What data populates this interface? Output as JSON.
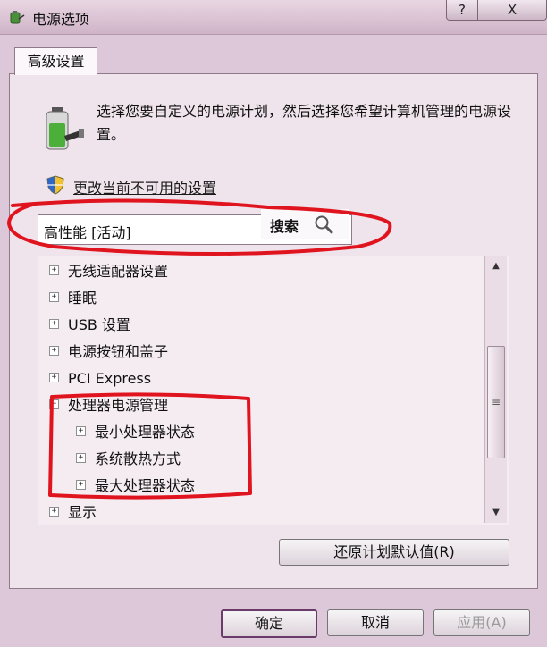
{
  "window": {
    "title": "电源选项",
    "help_button": "?",
    "close_button": "X"
  },
  "tab": {
    "label": "高级设置"
  },
  "description": "选择您要自定义的电源计划，然后选择您希望计算机管理的电源设置。",
  "link": "更改当前不可用的设置",
  "plan_select": {
    "value": "高性能 [活动]"
  },
  "search": {
    "label": "搜索"
  },
  "tree": {
    "items": [
      {
        "label": "无线适配器设置",
        "expander": "+"
      },
      {
        "label": "睡眠",
        "expander": "+"
      },
      {
        "label": "USB 设置",
        "expander": "+"
      },
      {
        "label": "电源按钮和盖子",
        "expander": "+"
      },
      {
        "label": "PCI Express",
        "expander": "+"
      },
      {
        "label": "处理器电源管理",
        "expander": "−"
      },
      {
        "label": "最小处理器状态",
        "expander": "+"
      },
      {
        "label": "系统散热方式",
        "expander": "+"
      },
      {
        "label": "最大处理器状态",
        "expander": "+"
      },
      {
        "label": "显示",
        "expander": "+"
      }
    ]
  },
  "buttons": {
    "restore": "还原计划默认值(R)",
    "ok": "确定",
    "cancel": "取消",
    "apply": "应用(A)"
  },
  "annotation_color": "#e0141e"
}
